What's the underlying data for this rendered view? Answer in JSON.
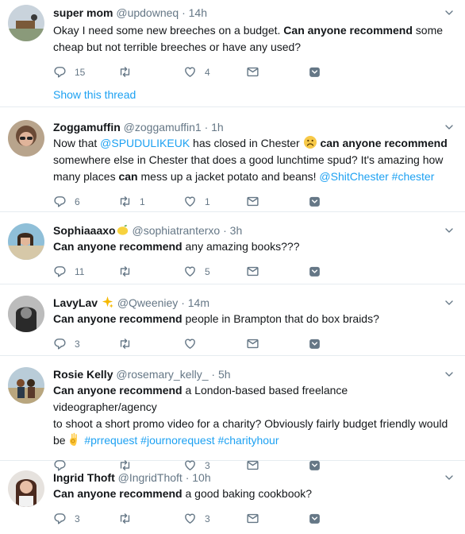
{
  "tweets": [
    {
      "name": "super mom",
      "handle": "@updowneq",
      "time": "14h",
      "pre": "Okay I need some new breeches on a budget. ",
      "bold": "Can anyone recommend",
      "post": " some cheap but not terrible breeches or have any used?",
      "replies": "15",
      "retweets": "",
      "likes": "4",
      "show_thread": "Show this thread"
    },
    {
      "name": "Zoggamuffin",
      "handle": "@zoggamuffin1",
      "time": "1h",
      "line1_pre": "Now that ",
      "line1_link": "@SPUDULIKEUK",
      "line1_mid": " has closed in Chester ",
      "line1_bold": "can anyone recommend",
      "line2": "somewhere else in Chester that does a good lunchtime spud? It's amazing how",
      "line3_pre": "many places ",
      "line3_bold": "can",
      "line3_mid": " mess up a jacket potato and beans! ",
      "line3_link1": "@ShitChester",
      "line3_link2": "#chester",
      "replies": "6",
      "retweets": "1",
      "likes": "1"
    },
    {
      "name": "Sophiaaaxo",
      "handle": "@sophiatranterxo",
      "time": "3h",
      "bold": "Can anyone recommend",
      "post": " any amazing books???",
      "replies": "11",
      "retweets": "",
      "likes": "5"
    },
    {
      "name": "LavyLav",
      "handle": "@Qweeniey",
      "time": "14m",
      "bold": "Can anyone recommend",
      "post": " people in Brampton that do box braids?",
      "replies": "3",
      "retweets": "",
      "likes": ""
    },
    {
      "name": "Rosie Kelly",
      "handle": "@rosemary_kelly_",
      "time": "5h",
      "bold": "Can anyone recommend",
      "line1_post": " a London-based based freelance videographer/agency",
      "line2": "to shoot a short promo video for a charity? Obviously fairly budget friendly would",
      "line3_pre": "be ",
      "tags": "#prrequest #journorequest #charityhour",
      "replies": "",
      "retweets": "",
      "likes": "3"
    },
    {
      "name": "Ingrid Thoft",
      "handle": "@IngridThoft",
      "time": "10h",
      "bold": "Can anyone recommend",
      "post": " a good baking cookbook?",
      "replies": "3",
      "retweets": "",
      "likes": "3"
    }
  ],
  "dot": "·",
  "colors": {
    "link": "#1da1f2",
    "muted": "#657786",
    "divider": "#e6ecf0"
  }
}
